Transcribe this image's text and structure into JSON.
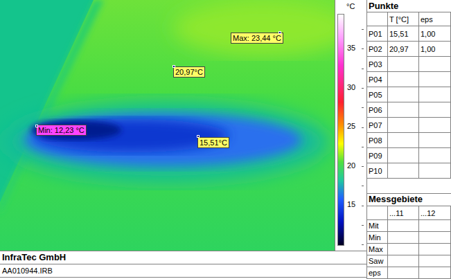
{
  "annotations": [
    {
      "text": "Max: 23,44 °C",
      "color": "#ffff66"
    },
    {
      "text": "20,97°C",
      "color": "#ffff66"
    },
    {
      "text": "Min: 12,23 °C",
      "color": "#ff44ff"
    },
    {
      "text": "15,51°C",
      "color": "#ffff66"
    }
  ],
  "scale": {
    "unit": "°C",
    "ticks": [
      "35",
      "30",
      "25",
      "20",
      "15"
    ]
  },
  "footer": {
    "company": "InfraTec GmbH",
    "file": "AA010944.IRB"
  },
  "points": {
    "title": "Punkte",
    "columns": [
      "",
      "T [°C]",
      "eps"
    ],
    "rows": [
      {
        "id": "P01",
        "t": "15,51",
        "eps": "1,00"
      },
      {
        "id": "P02",
        "t": "20,97",
        "eps": "1,00"
      },
      {
        "id": "P03",
        "t": "",
        "eps": ""
      },
      {
        "id": "P04",
        "t": "",
        "eps": ""
      },
      {
        "id": "P05",
        "t": "",
        "eps": ""
      },
      {
        "id": "P06",
        "t": "",
        "eps": ""
      },
      {
        "id": "P07",
        "t": "",
        "eps": ""
      },
      {
        "id": "P08",
        "t": "",
        "eps": ""
      },
      {
        "id": "P09",
        "t": "",
        "eps": ""
      },
      {
        "id": "P10",
        "t": "",
        "eps": ""
      }
    ]
  },
  "areas": {
    "title": "Messgebiete",
    "columns": [
      "",
      "...11",
      "...12"
    ],
    "rows": [
      "Mit",
      "Min",
      "Max",
      "Saw",
      "eps"
    ]
  }
}
